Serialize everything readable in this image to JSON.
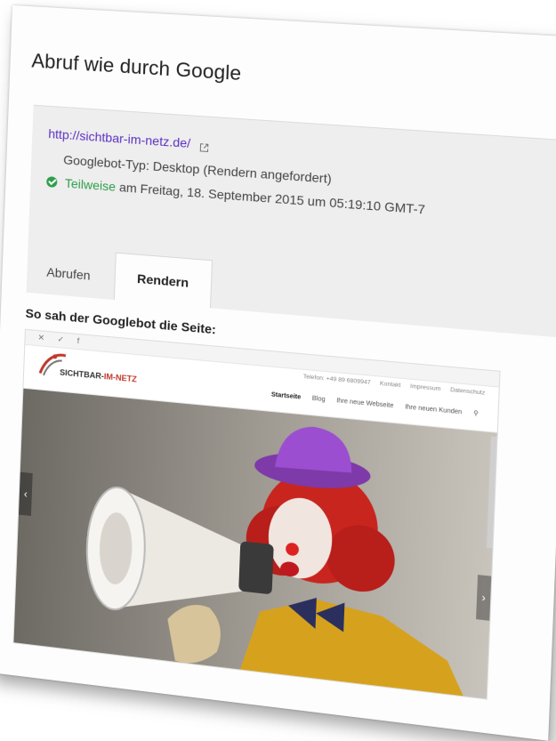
{
  "card": {
    "title": "Abruf wie durch Google"
  },
  "result": {
    "url": "http://sichtbar-im-netz.de/",
    "bot_type": "Googlebot-Typ: Desktop (Rendern angefordert)",
    "status_word": "Teilweise",
    "status_rest": "am Freitag, 18. September 2015 um 05:19:10 GMT-7"
  },
  "tabs": [
    "Abrufen",
    "Rendern"
  ],
  "preview": {
    "heading": "So sah der Googlebot die Seite:",
    "social": "✕ ✓ f",
    "contact": [
      "Telefon: +49 89 6809947",
      "Kontakt",
      "Impressum",
      "Datenschutz"
    ],
    "logo_left": "SICHTBAR-",
    "logo_right": "IM-NETZ",
    "nav": [
      "Startseite",
      "Blog",
      "Ihre neue Webseite",
      "Ihre neuen Kunden"
    ]
  },
  "colors": {
    "link": "#5c2fc2",
    "success": "#2d9e49"
  }
}
